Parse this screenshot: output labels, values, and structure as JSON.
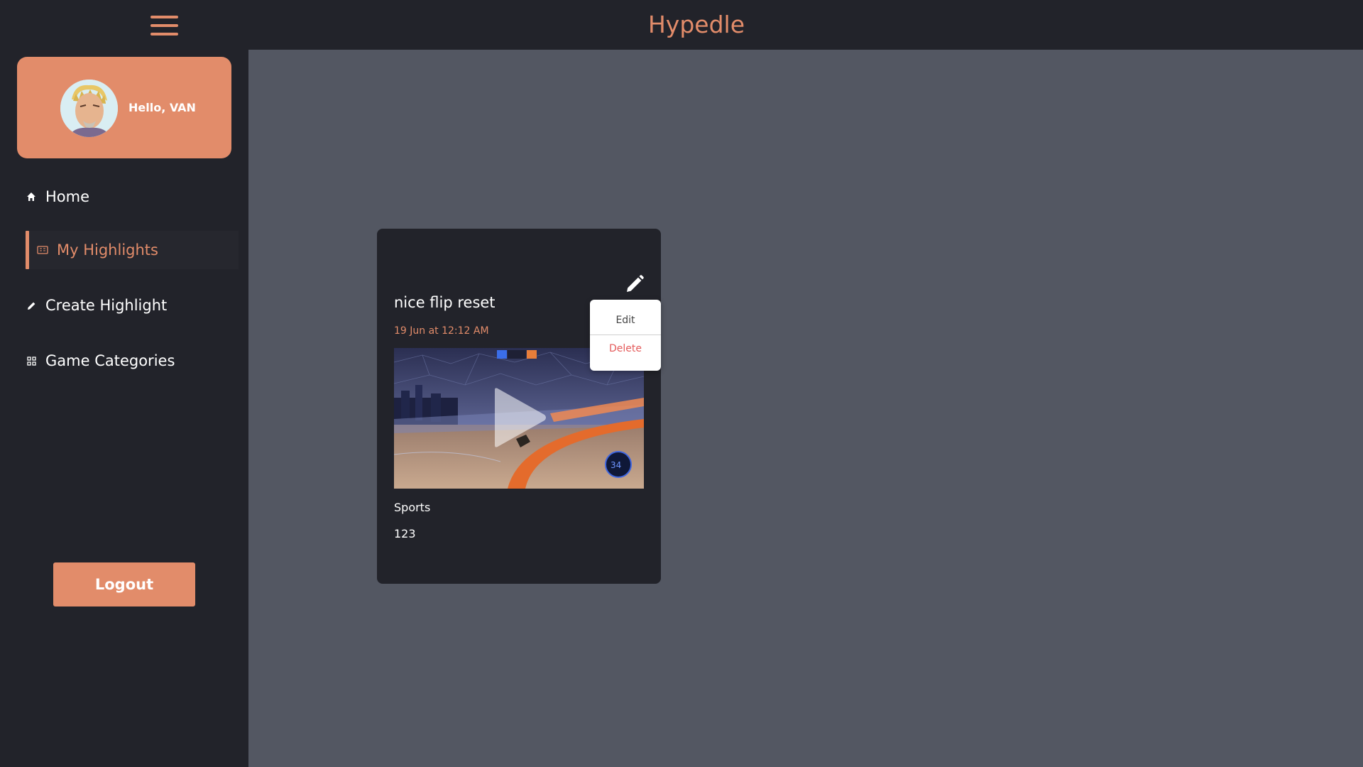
{
  "app": {
    "title": "Hypedle"
  },
  "colors": {
    "accent": "#e28c6a",
    "sidebar_bg": "#22232a",
    "main_bg": "#535762",
    "delete": "#e45b5b"
  },
  "header": {
    "menu_icon": "hamburger-menu-icon"
  },
  "profile": {
    "greeting": "Hello, VAN",
    "avatar_icon": "user-avatar"
  },
  "sidebar": {
    "items": [
      {
        "label": "Home",
        "icon": "home-icon",
        "active": false
      },
      {
        "label": "My Highlights",
        "icon": "highlights-list-icon",
        "active": true
      },
      {
        "label": "Create Highlight",
        "icon": "pencil-icon",
        "active": false
      },
      {
        "label": "Game Categories",
        "icon": "grid-icon",
        "active": false
      }
    ],
    "logout_label": "Logout"
  },
  "highlight_card": {
    "title": "nice flip reset",
    "date": "19 Jun at 12:12 AM",
    "category": "Sports",
    "count": "123",
    "thumbnail_icon": "video-thumbnail",
    "play_icon": "play-icon",
    "edit_icon": "pencil-icon"
  },
  "dropdown": {
    "edit_label": "Edit",
    "delete_label": "Delete"
  }
}
